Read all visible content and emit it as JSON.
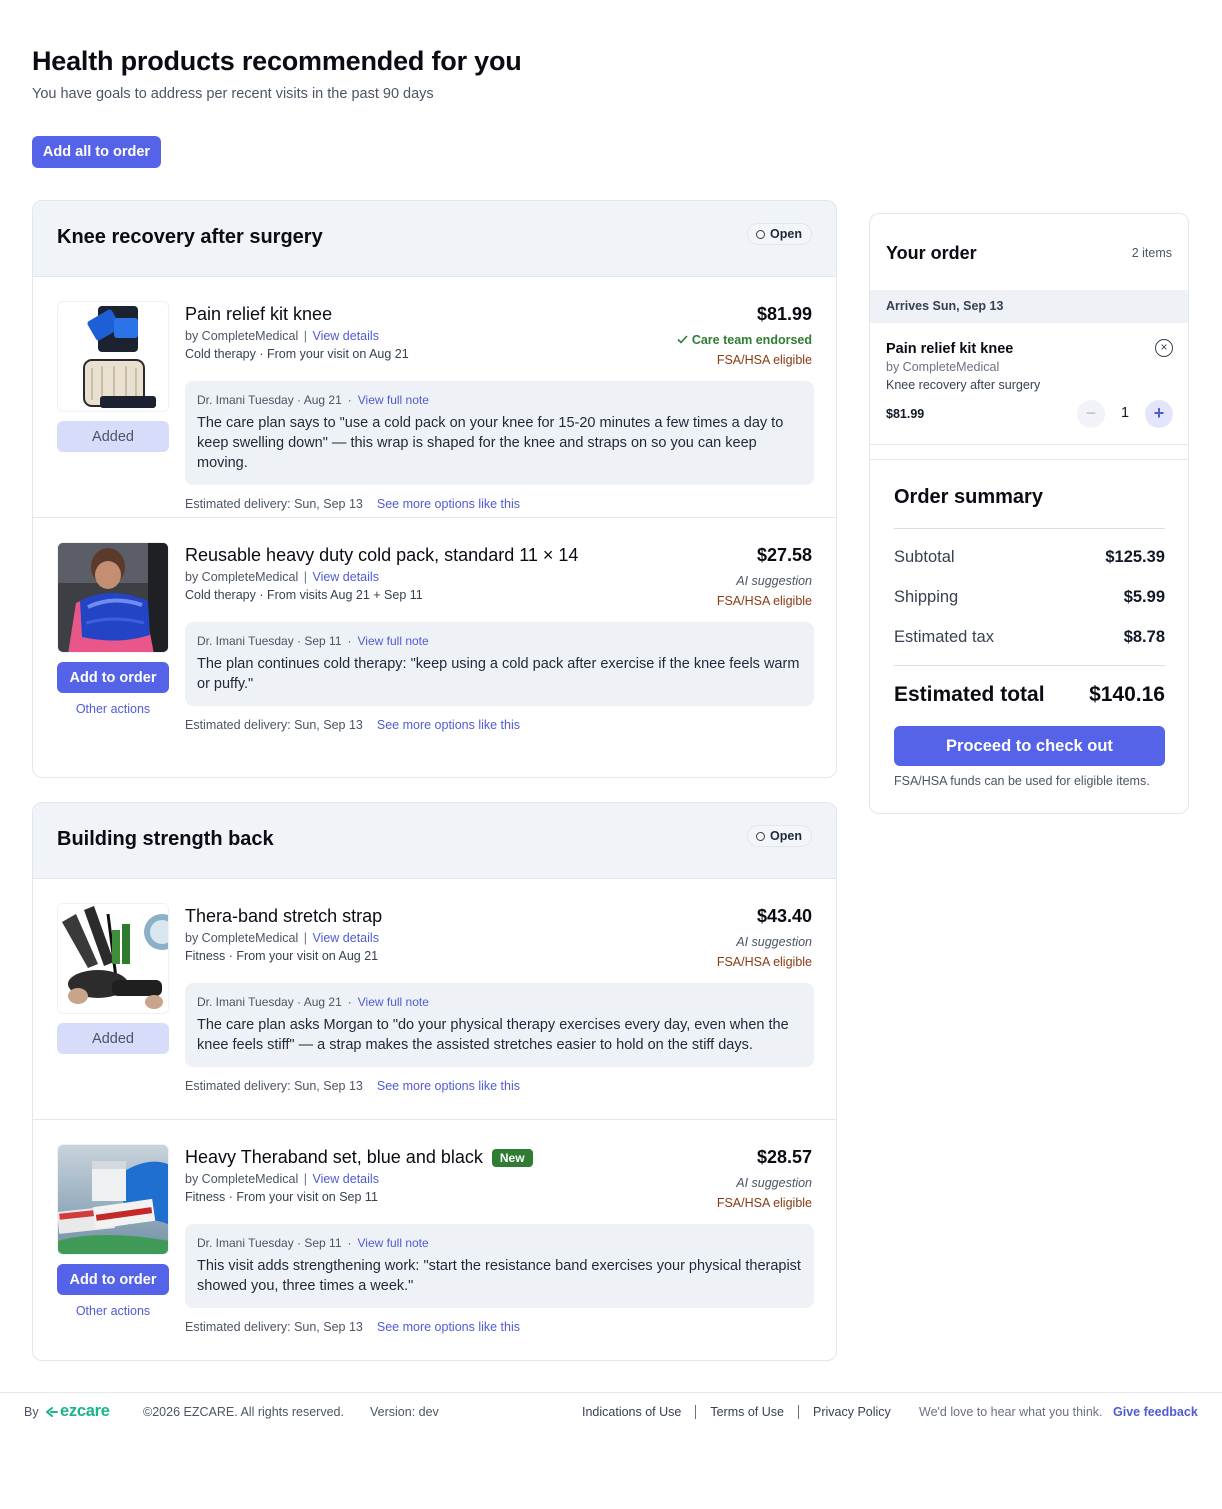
{
  "page": {
    "title": "Health products recommended for you",
    "subtitle": "You have goals to address per recent visits in the past 90 days",
    "add_all_label": "Add all to order"
  },
  "goals": [
    {
      "title": "Knee recovery after surgery",
      "status": "Open",
      "products": [
        {
          "name": "Pain relief kit knee",
          "vendor_prefix": "by CompleteMedical",
          "vendor_sep": "|",
          "details_link": "View details",
          "meta": "Cold therapy · From your visit on Aug 21",
          "price": "$81.99",
          "tag1": "Care team endorsed",
          "tag1_icon": "check-icon",
          "tag2": "FSA/HSA eligible",
          "action": "Added",
          "note_author": "Dr. Imani Tuesday · Aug 21",
          "note_dot": "·",
          "note_link": "View full note",
          "note_text": "The care plan says to \"use a cold pack on your knee for 15-20 minutes a few times a day to keep swelling down\" — this wrap is shaped for the knee and straps on so you can keep moving.",
          "delivery": "Estimated delivery: Sun, Sep 13",
          "more_link": "See more options like this"
        },
        {
          "name": "Reusable heavy duty cold pack, standard 11 × 14",
          "vendor_prefix": "by CompleteMedical",
          "vendor_sep": "|",
          "details_link": "View details",
          "meta": "Cold therapy · From visits Aug 21 + Sep 11",
          "price": "$27.58",
          "tag1": "AI suggestion",
          "tag2": "FSA/HSA eligible",
          "action": "Add to order",
          "other_actions": "Other actions",
          "note_author": "Dr. Imani Tuesday · Sep 11",
          "note_dot": "·",
          "note_link": "View full note",
          "note_text": "The plan continues cold therapy: \"keep using a cold pack after exercise if the knee feels warm or puffy.\"",
          "delivery": "Estimated delivery: Sun, Sep 13",
          "more_link": "See more options like this"
        }
      ]
    },
    {
      "title": "Building strength back",
      "status": "Open",
      "products": [
        {
          "name": "Thera-band stretch strap",
          "vendor_prefix": "by CompleteMedical",
          "vendor_sep": "|",
          "details_link": "View details",
          "meta": "Fitness · From your visit on Aug 21",
          "price": "$43.40",
          "tag1": "AI suggestion",
          "tag2": "FSA/HSA eligible",
          "action": "Added",
          "note_author": "Dr. Imani Tuesday · Aug 21",
          "note_dot": "·",
          "note_link": "View full note",
          "note_text": "The care plan asks Morgan to \"do your physical therapy exercises every day, even when the knee feels stiff\" — a strap makes the assisted stretches easier to hold on the stiff days.",
          "delivery": "Estimated delivery: Sun, Sep 13",
          "more_link": "See more options like this"
        },
        {
          "name": "Heavy Theraband set, blue and black",
          "badge": "New",
          "vendor_prefix": "by CompleteMedical",
          "vendor_sep": "|",
          "details_link": "View details",
          "meta": "Fitness · From your visit on Sep 11",
          "price": "$28.57",
          "tag1": "AI suggestion",
          "tag2": "FSA/HSA eligible",
          "action": "Add to order",
          "other_actions": "Other actions",
          "note_author": "Dr. Imani Tuesday · Sep 11",
          "note_dot": "·",
          "note_link": "View full note",
          "note_text": "This visit adds strengthening work: \"start the resistance band exercises your physical therapist showed you, three times a week.\"",
          "delivery": "Estimated delivery: Sun, Sep 13",
          "more_link": "See more options like this"
        }
      ]
    }
  ],
  "order": {
    "title": "Your order",
    "count": "2 items",
    "arrives": "Arrives Sun, Sep 13",
    "item": {
      "name": "Pain relief kit knee",
      "vendor": "by CompleteMedical",
      "goal": "Knee recovery after surgery",
      "price": "$81.99",
      "qty": "1",
      "minus": "−",
      "plus": "+",
      "remove": "×"
    },
    "summary": {
      "title": "Order summary",
      "subtotal_label": "Subtotal",
      "subtotal": "$125.39",
      "shipping_label": "Shipping",
      "shipping": "$5.99",
      "tax_label": "Estimated tax",
      "tax": "$8.78",
      "total_label": "Estimated total",
      "total": "$140.16",
      "checkout_label": "Proceed to check out",
      "fsa_note": "FSA/HSA funds can be used for eligible items."
    }
  },
  "footer": {
    "by": "By",
    "logo": "ezcare",
    "copyright": "©2026 EZCARE. All rights reserved.",
    "version": "Version: dev",
    "links": [
      "Indications of Use",
      "Terms of Use",
      "Privacy Policy"
    ],
    "feedback_text": "We'd love to hear what you think.",
    "feedback_link": "Give feedback"
  },
  "colors": {
    "accent": "#5563e8",
    "link": "#4f5bd5",
    "endorsed": "#2f7d32",
    "fsa": "#8a3a12",
    "brand": "#1bb38f"
  }
}
